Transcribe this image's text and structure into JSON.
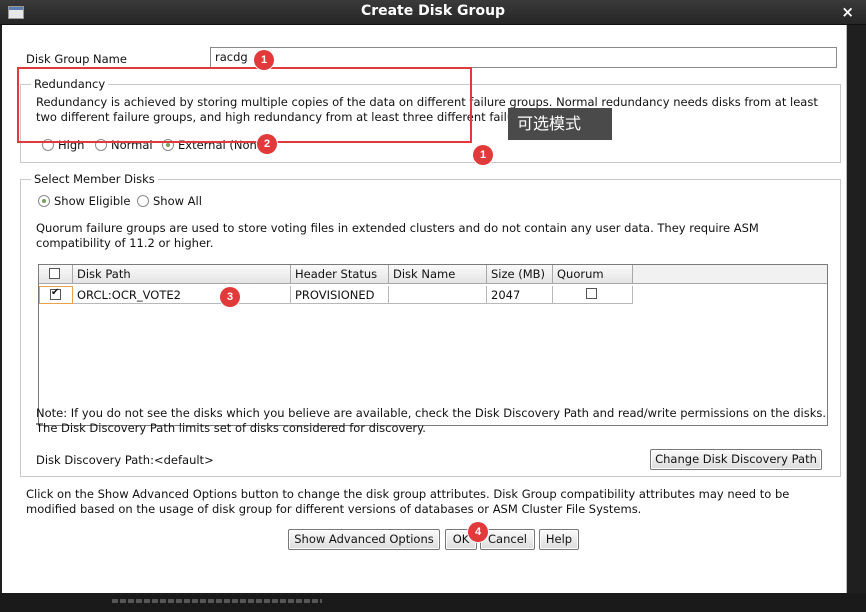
{
  "window": {
    "title": "Create Disk Group",
    "close_glyph": "×",
    "menu_icon": "window-menu-icon"
  },
  "disk_group_name": {
    "label": "Disk Group Name",
    "value": "racdg"
  },
  "redundancy": {
    "legend": "Redundancy",
    "description": "Redundancy is achieved by storing multiple copies of the data on different failure groups. Normal redundancy needs disks from at least two different failure groups, and high redundancy from at least three different failure groups.",
    "options": [
      {
        "label": "High",
        "selected": false
      },
      {
        "label": "Normal",
        "selected": false
      },
      {
        "label": "External (None)",
        "selected": true
      }
    ],
    "visible_selected_label": "External (Non"
  },
  "member_disks": {
    "legend": "Select Member Disks",
    "filter_options": [
      {
        "label": "Show Eligible",
        "selected": true
      },
      {
        "label": "Show All",
        "selected": false
      }
    ],
    "quorum_note": "Quorum failure groups are used to store voting files in extended clusters and do not contain any user data. They require ASM compatibility of 11.2 or higher.",
    "table": {
      "columns": [
        "",
        "Disk Path",
        "Header Status",
        "Disk Name",
        "Size (MB)",
        "Quorum"
      ],
      "rows": [
        {
          "selected": true,
          "disk_path": "ORCL:OCR_VOTE2",
          "header_status": "PROVISIONED",
          "disk_name": "",
          "size_mb": "2047",
          "quorum": false
        }
      ]
    },
    "discovery_note": "Note: If you do not see the disks which you believe are available, check the Disk Discovery Path and read/write permissions on the disks. The Disk Discovery Path limits set of disks considered for discovery.",
    "discovery_path_label": "Disk Discovery Path:<default>",
    "change_path_button": "Change Disk Discovery Path"
  },
  "advanced_note": "Click on the Show Advanced Options button to change the disk group attributes. Disk Group compatibility attributes may need to be modified based on the usage of disk group for different versions of databases or ASM Cluster File Systems.",
  "buttons": {
    "advanced": "Show Advanced Options",
    "ok": "OK",
    "cancel": "Cancel",
    "help": "Help"
  },
  "annotations": {
    "badges": [
      "1",
      "2",
      "3",
      "4",
      "1"
    ],
    "tooltip": "可选模式",
    "highlight_color": "#e23a3a"
  },
  "colors": {
    "title_bar": "#2f2f2f",
    "dialog_bg": "#ffffff",
    "radio_dot": "#6fa35a",
    "annotation_red": "#e23a3a",
    "tooltip_bg": "#4a4a4a"
  }
}
